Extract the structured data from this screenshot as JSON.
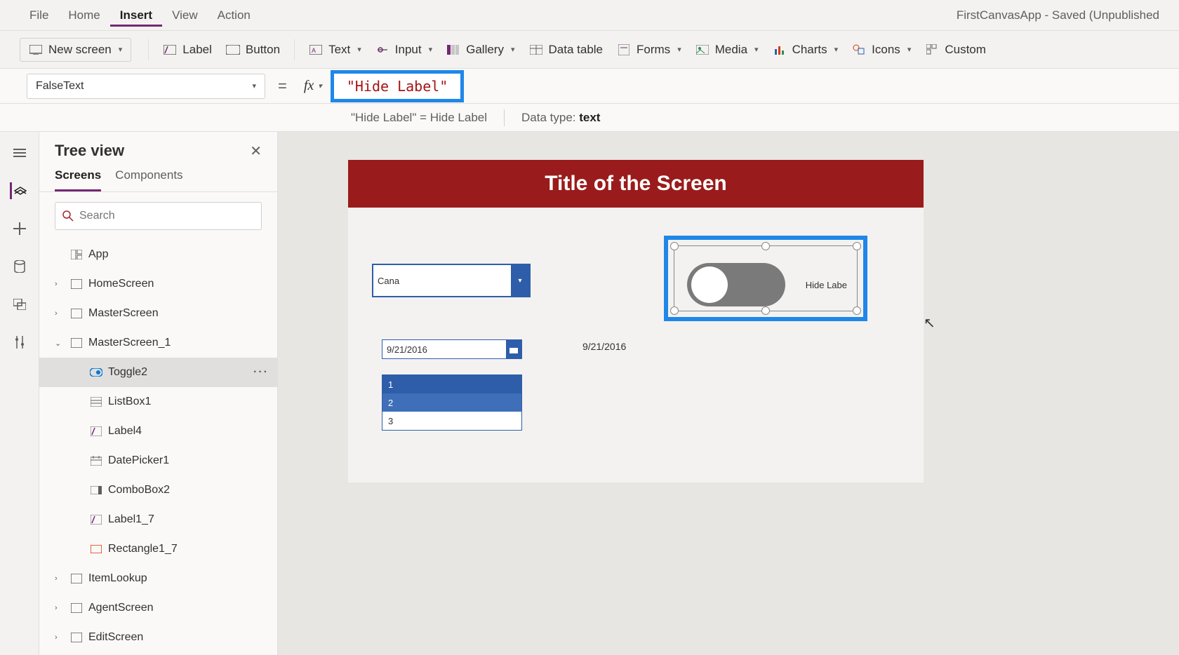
{
  "menubar": {
    "items": [
      "File",
      "Home",
      "Insert",
      "View",
      "Action"
    ],
    "active": "Insert",
    "app_title": "FirstCanvasApp - Saved (Unpublished"
  },
  "ribbon": {
    "new_screen": "New screen",
    "label": "Label",
    "button": "Button",
    "text": "Text",
    "input": "Input",
    "gallery": "Gallery",
    "data_table": "Data table",
    "forms": "Forms",
    "media": "Media",
    "charts": "Charts",
    "icons": "Icons",
    "custom": "Custom"
  },
  "formula": {
    "property": "FalseText",
    "code": "\"Hide Label\"",
    "info_expr": "\"Hide Label\"  =  Hide Label",
    "data_type_label": "Data type: ",
    "data_type_value": "text"
  },
  "tree": {
    "title": "Tree view",
    "tabs": [
      "Screens",
      "Components"
    ],
    "active_tab": "Screens",
    "search_placeholder": "Search",
    "items": [
      {
        "label": "App",
        "depth": 0,
        "icon": "app",
        "expand": ""
      },
      {
        "label": "HomeScreen",
        "depth": 0,
        "icon": "screen",
        "expand": "›"
      },
      {
        "label": "MasterScreen",
        "depth": 0,
        "icon": "screen",
        "expand": "›"
      },
      {
        "label": "MasterScreen_1",
        "depth": 0,
        "icon": "screen",
        "expand": "⌄"
      },
      {
        "label": "Toggle2",
        "depth": 1,
        "icon": "toggle",
        "expand": "",
        "selected": true
      },
      {
        "label": "ListBox1",
        "depth": 1,
        "icon": "listbox",
        "expand": ""
      },
      {
        "label": "Label4",
        "depth": 1,
        "icon": "label",
        "expand": ""
      },
      {
        "label": "DatePicker1",
        "depth": 1,
        "icon": "datepicker",
        "expand": ""
      },
      {
        "label": "ComboBox2",
        "depth": 1,
        "icon": "combobox",
        "expand": ""
      },
      {
        "label": "Label1_7",
        "depth": 1,
        "icon": "label",
        "expand": ""
      },
      {
        "label": "Rectangle1_7",
        "depth": 1,
        "icon": "rectangle",
        "expand": ""
      },
      {
        "label": "ItemLookup",
        "depth": 0,
        "icon": "screen",
        "expand": "›"
      },
      {
        "label": "AgentScreen",
        "depth": 0,
        "icon": "screen",
        "expand": "›"
      },
      {
        "label": "EditScreen",
        "depth": 0,
        "icon": "screen",
        "expand": "›"
      }
    ]
  },
  "canvas": {
    "title": "Title of the Screen",
    "combo_value": "Cana",
    "date_value": "9/21/2016",
    "date_label": "9/21/2016",
    "list_items": [
      "1",
      "2",
      "3"
    ],
    "toggle_label": "Hide Labe"
  }
}
